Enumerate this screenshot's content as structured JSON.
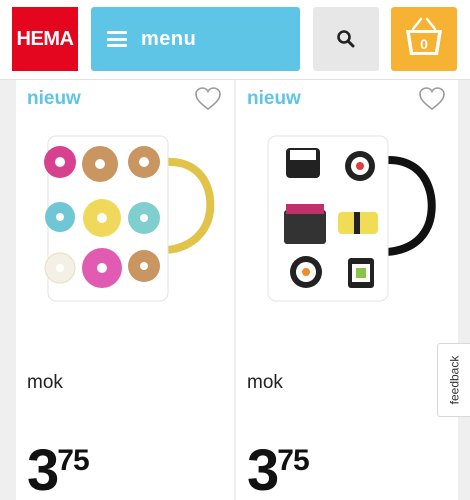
{
  "header": {
    "logo_text": "HEMA",
    "menu_label": "menu",
    "cart_count": "0"
  },
  "products": [
    {
      "badge": "nieuw",
      "name": "mok",
      "price_int": "3",
      "price_dec": "75",
      "image": "donut-mug"
    },
    {
      "badge": "nieuw",
      "name": "mok",
      "price_int": "3",
      "price_dec": "75",
      "image": "sushi-mug"
    }
  ],
  "feedback_label": "feedback",
  "colors": {
    "brand_red": "#e4051f",
    "menu_blue": "#5fc5e6",
    "cart_yellow": "#f5b233",
    "badge_blue": "#5fc5e6"
  }
}
